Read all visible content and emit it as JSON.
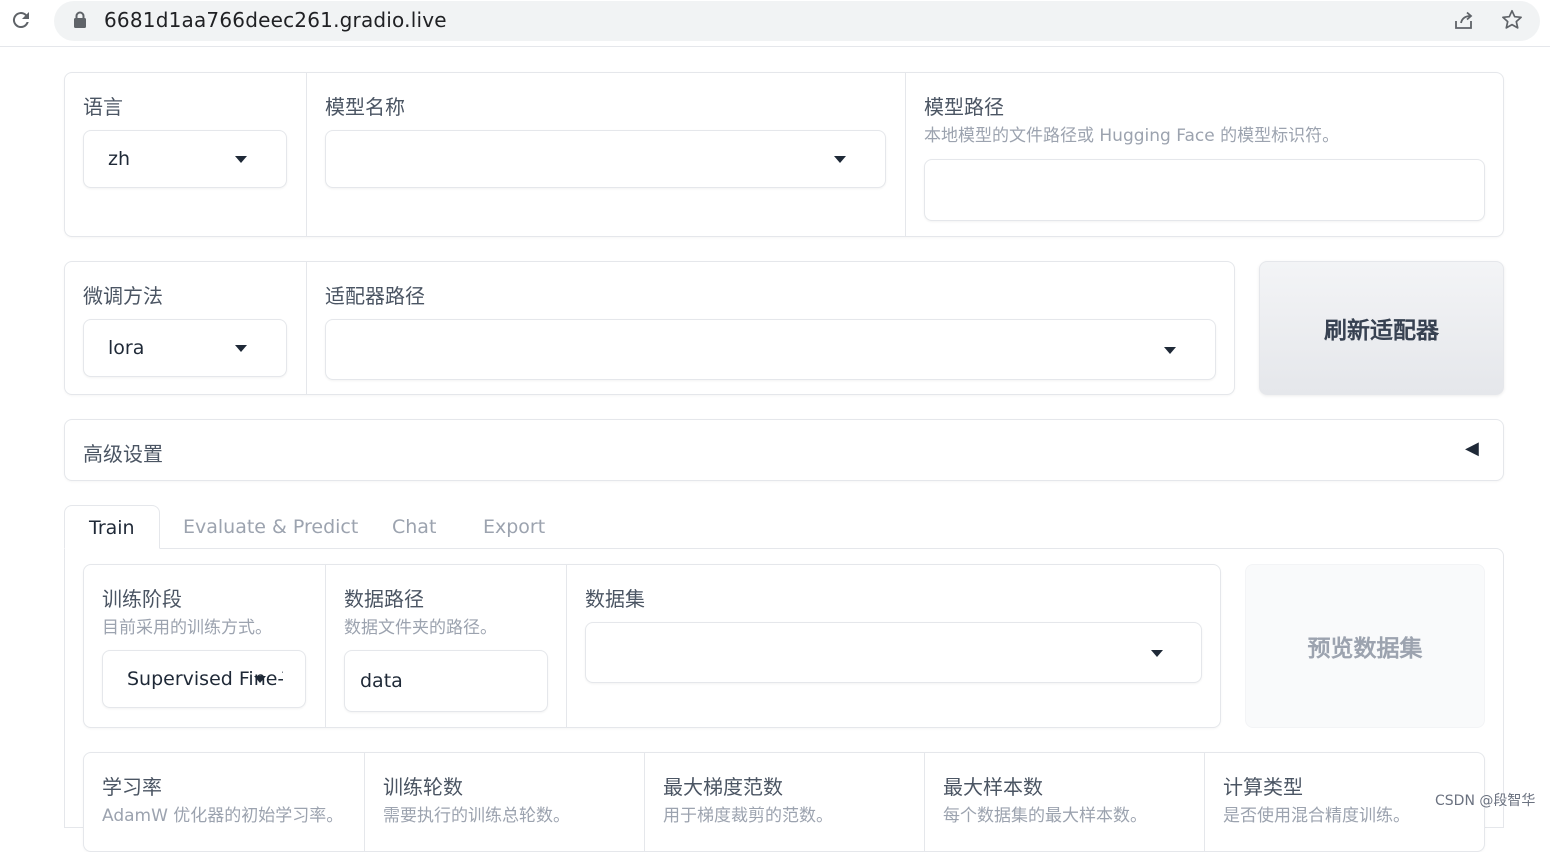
{
  "browser": {
    "url": "6681d1aa766deec261.gradio.live"
  },
  "row1": {
    "lang": {
      "label": "语言",
      "value": "zh"
    },
    "model_name": {
      "label": "模型名称",
      "value": ""
    },
    "model_path": {
      "label": "模型路径",
      "info": "本地模型的文件路径或 Hugging Face 的模型标识符。",
      "value": ""
    }
  },
  "row2": {
    "finetune": {
      "label": "微调方法",
      "value": "lora"
    },
    "adapter_path": {
      "label": "适配器路径",
      "value": ""
    },
    "refresh_label": "刷新适配器"
  },
  "advanced": {
    "label": "高级设置",
    "arrow": "◀"
  },
  "tabs": [
    {
      "label": "Train"
    },
    {
      "label": "Evaluate & Predict"
    },
    {
      "label": "Chat"
    },
    {
      "label": "Export"
    }
  ],
  "train": {
    "stage": {
      "label": "训练阶段",
      "info": "目前采用的训练方式。",
      "value": "Supervised Fine-Tuning"
    },
    "data_dir": {
      "label": "数据路径",
      "info": "数据文件夹的路径。",
      "value": "data"
    },
    "dataset": {
      "label": "数据集",
      "value": ""
    },
    "preview_label": "预览数据集",
    "params": [
      {
        "label": "学习率",
        "info": "AdamW 优化器的初始学习率。"
      },
      {
        "label": "训练轮数",
        "info": "需要执行的训练总轮数。"
      },
      {
        "label": "最大梯度范数",
        "info": "用于梯度裁剪的范数。"
      },
      {
        "label": "最大样本数",
        "info": "每个数据集的最大样本数。"
      },
      {
        "label": "计算类型",
        "info": "是否使用混合精度训练。"
      }
    ]
  },
  "watermark": "CSDN @段智华"
}
